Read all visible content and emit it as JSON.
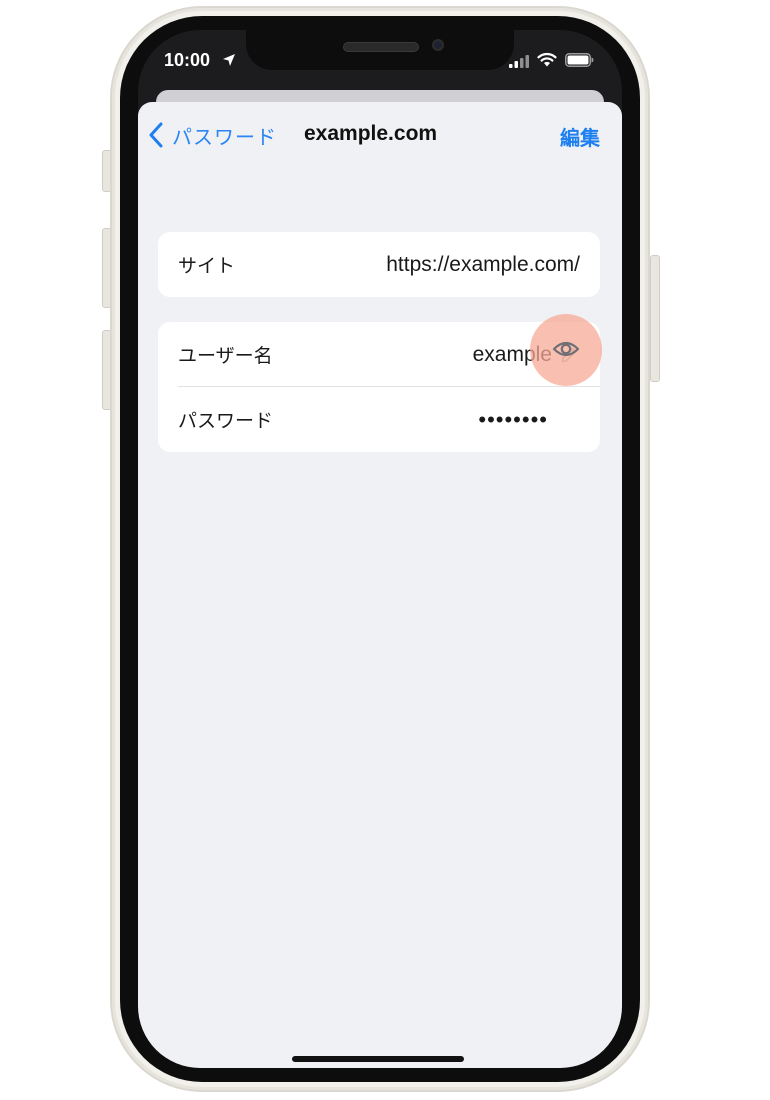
{
  "status_bar": {
    "time": "10:00"
  },
  "nav": {
    "back_label": "パスワード",
    "title": "example.com",
    "edit_label": "編集"
  },
  "site_section": {
    "label": "サイト",
    "value": "https://example.com/"
  },
  "credentials_section": {
    "username_label": "ユーザー名",
    "username_value": "example",
    "password_label": "パスワード",
    "password_value": "••••••••"
  },
  "icons": {
    "back": "chevron-left-icon",
    "edit_username": "pencil-icon",
    "reveal_password": "eye-icon",
    "location": "location-arrow-icon",
    "signal": "cellular-signal-icon",
    "wifi": "wifi-icon",
    "battery": "battery-icon"
  },
  "colors": {
    "accent": "#1d7ff0",
    "background": "#f0f1f4",
    "highlight": "#f7aa96"
  }
}
